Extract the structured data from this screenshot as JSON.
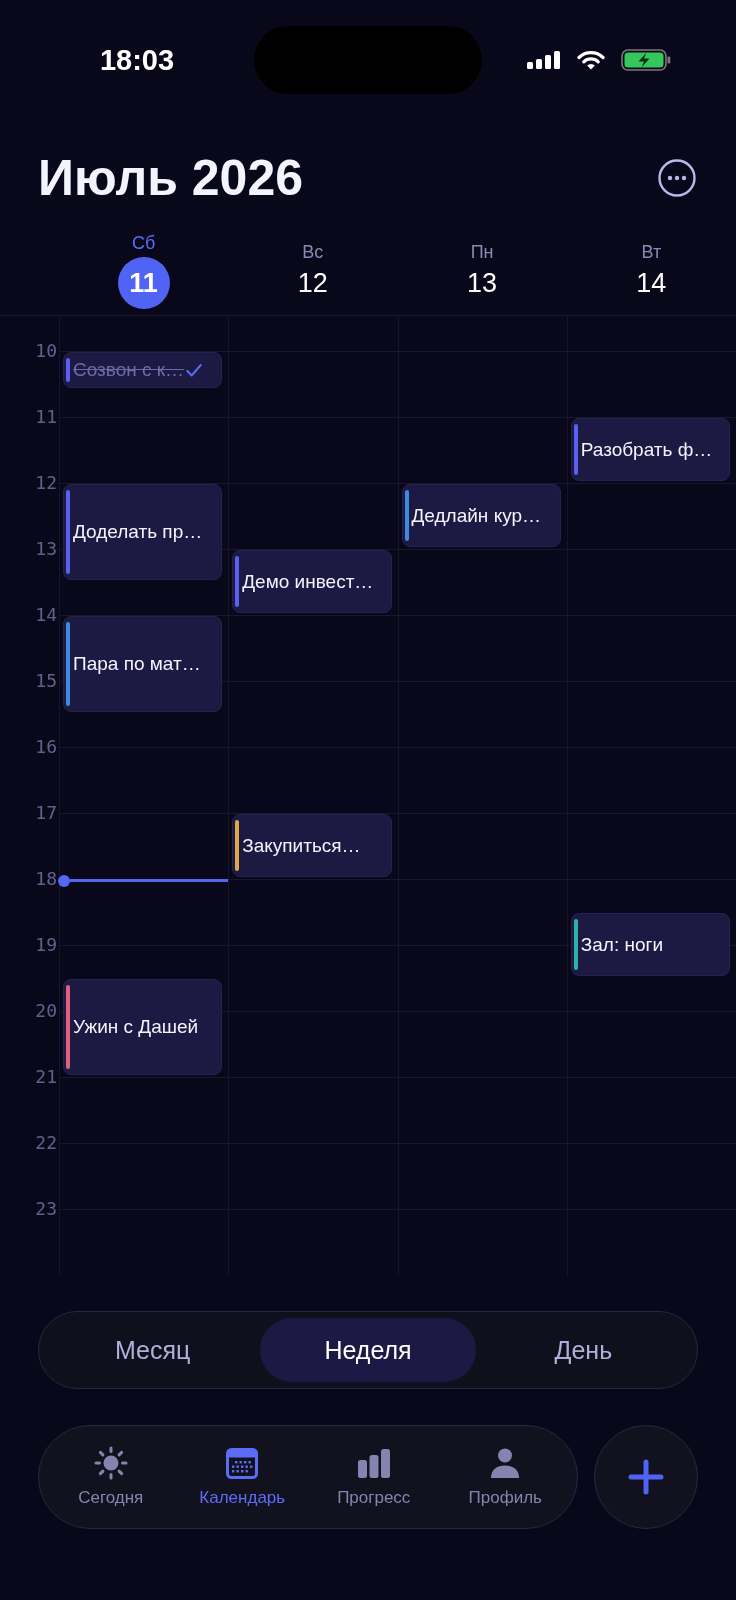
{
  "status_bar": {
    "time": "18:03"
  },
  "header": {
    "title": "Июль 2026"
  },
  "days": [
    {
      "weekday": "Сб",
      "date": "11",
      "selected": true,
      "events": [
        {
          "title": "Созвон с к…",
          "color": "#5a60f0",
          "done": true
        },
        {
          "title": "Доделать пр…",
          "color": "#5a60f0",
          "done": false
        },
        {
          "title": "Пара по мат…",
          "color": "#3d8be0",
          "done": false
        },
        {
          "title": "Ужин с Дашей",
          "color": "#e0607e",
          "done": false
        }
      ]
    },
    {
      "weekday": "Вс",
      "date": "12",
      "selected": false,
      "events": [
        {
          "title": "Демо инвест…",
          "color": "#5a60f0",
          "done": false
        },
        {
          "title": "Закупиться…",
          "color": "#e0a64a",
          "done": false
        }
      ]
    },
    {
      "weekday": "Пн",
      "date": "13",
      "selected": false,
      "events": [
        {
          "title": "Дедлайн кур…",
          "color": "#3d8be0",
          "done": false
        }
      ]
    },
    {
      "weekday": "Вт",
      "date": "14",
      "selected": false,
      "events": [
        {
          "title": "Разобрать ф…",
          "color": "#5a60f0",
          "done": false
        },
        {
          "title": "Зал: ноги",
          "color": "#2bb3a5",
          "done": false
        }
      ]
    }
  ],
  "hours": [
    "10",
    "11",
    "12",
    "13",
    "14",
    "15",
    "16",
    "17",
    "18",
    "19",
    "20",
    "21",
    "22",
    "23"
  ],
  "view_switcher": {
    "options": [
      {
        "label": "Месяц",
        "selected": false
      },
      {
        "label": "Неделя",
        "selected": true
      },
      {
        "label": "День",
        "selected": false
      }
    ]
  },
  "tab_bar": {
    "items": [
      {
        "label": "Сегодня",
        "kind": "today",
        "selected": false
      },
      {
        "label": "Календарь",
        "kind": "calendar",
        "selected": true
      },
      {
        "label": "Прогресс",
        "kind": "progress",
        "selected": false
      },
      {
        "label": "Профиль",
        "kind": "profile",
        "selected": false
      }
    ]
  }
}
